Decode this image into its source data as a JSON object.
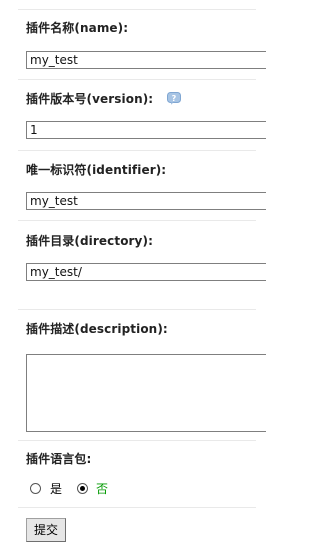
{
  "form": {
    "name": {
      "label": "插件名称(name):",
      "value": "my_test"
    },
    "version": {
      "label": "插件版本号(version):",
      "value": "1",
      "help_icon": "question-icon"
    },
    "identifier": {
      "label": "唯一标识符(identifier):",
      "value": "my_test"
    },
    "directory": {
      "label": "插件目录(directory):",
      "value": "my_test/"
    },
    "description": {
      "label": "插件描述(description):",
      "value": ""
    },
    "language_pack": {
      "label": "插件语言包:",
      "options": [
        {
          "label": "是",
          "selected": false,
          "color": "#000000"
        },
        {
          "label": "否",
          "selected": true,
          "color": "#009900"
        }
      ]
    },
    "submit_label": "提交"
  },
  "colors": {
    "help_icon": "#a7c4e4",
    "selected_option_text": "#009900"
  }
}
